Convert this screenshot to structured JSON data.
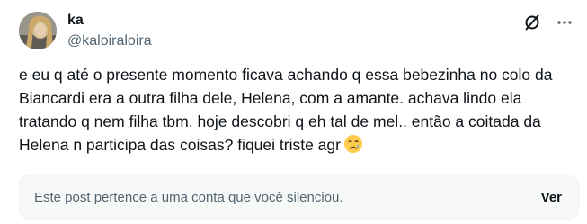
{
  "author": {
    "display_name": "ka",
    "handle": "@kaloiraloira"
  },
  "header": {
    "grok_icon": "grok-slash-icon",
    "more_icon": "more-horizontal-icon"
  },
  "post": {
    "text": "e eu q até o presente momento ficava achando q essa bebezinha no colo da Biancardi era a outra filha dele, Helena, com a amante. achava lindo ela tratando q nem filha tbm. hoje descobri q eh tal de mel.. então a coitada da Helena n participa das coisas? fiquei triste agr",
    "emoji": "crying-face-emoji"
  },
  "muted_notice": {
    "text": "Este post pertence a uma conta que você silenciou.",
    "view_label": "Ver"
  },
  "colors": {
    "primary_text": "#0f1419",
    "secondary_text": "#536471",
    "card_background": "#f7f9f9"
  }
}
